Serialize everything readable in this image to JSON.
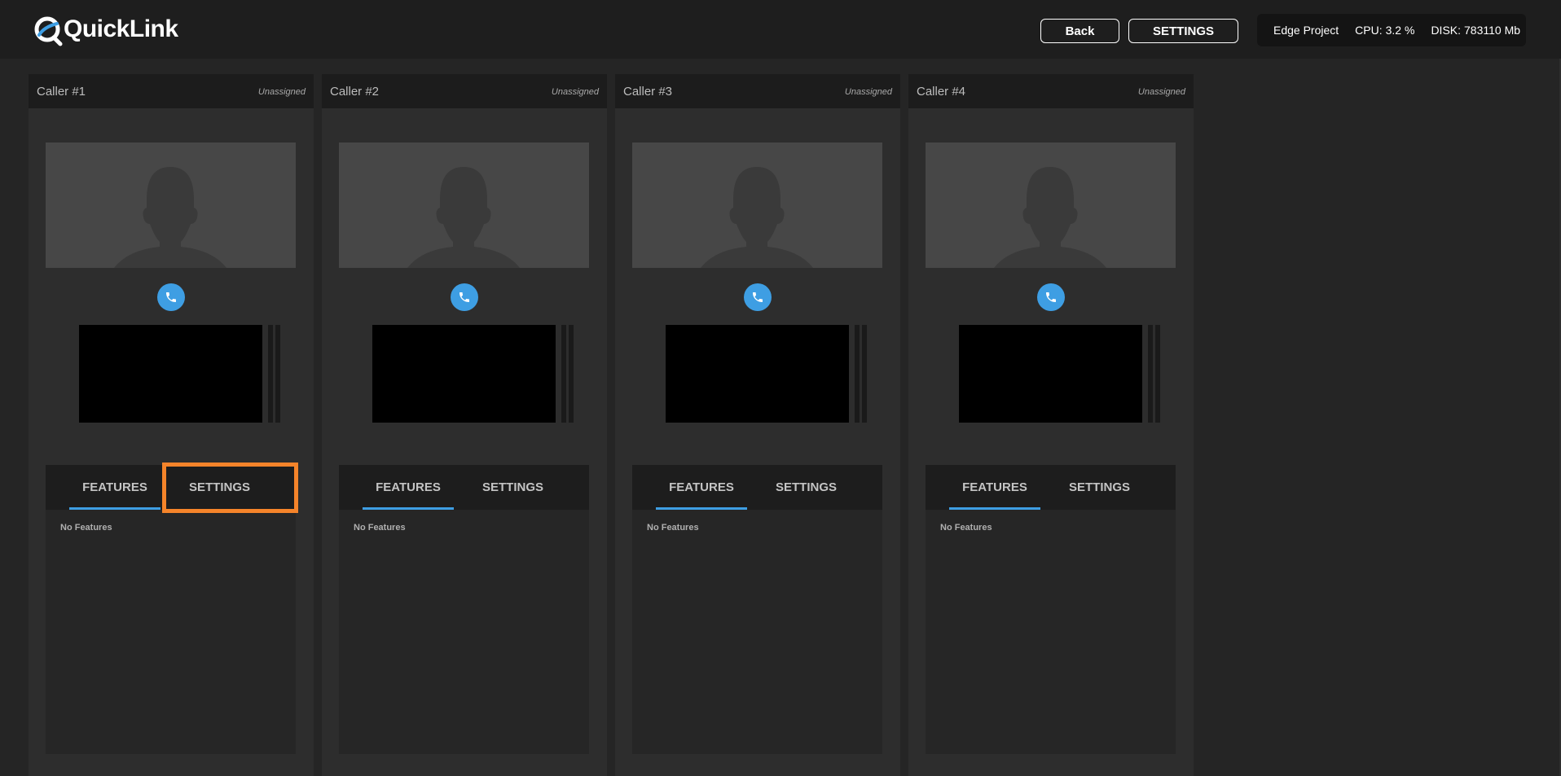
{
  "app": {
    "brand": "QuickLink"
  },
  "header": {
    "back_label": "Back",
    "settings_label": "SETTINGS",
    "project_name": "Edge Project",
    "cpu_label": "CPU:",
    "cpu_value": "3.2 %",
    "disk_label": "DISK:",
    "disk_value": "783110 Mb"
  },
  "callers": [
    {
      "name": "Caller #1",
      "status": "Unassigned",
      "tabs": {
        "features": "FEATURES",
        "settings": "SETTINGS"
      },
      "empty_text": "No Features"
    },
    {
      "name": "Caller #2",
      "status": "Unassigned",
      "tabs": {
        "features": "FEATURES",
        "settings": "SETTINGS"
      },
      "empty_text": "No Features"
    },
    {
      "name": "Caller #3",
      "status": "Unassigned",
      "tabs": {
        "features": "FEATURES",
        "settings": "SETTINGS"
      },
      "empty_text": "No Features"
    },
    {
      "name": "Caller #4",
      "status": "Unassigned",
      "tabs": {
        "features": "FEATURES",
        "settings": "SETTINGS"
      },
      "empty_text": "No Features"
    }
  ],
  "colors": {
    "accent": "#3e9ee3",
    "highlight": "#f5842a",
    "background": "#252525"
  },
  "icons": [
    "quicklink-logo-icon",
    "phone-icon",
    "person-placeholder-icon"
  ]
}
